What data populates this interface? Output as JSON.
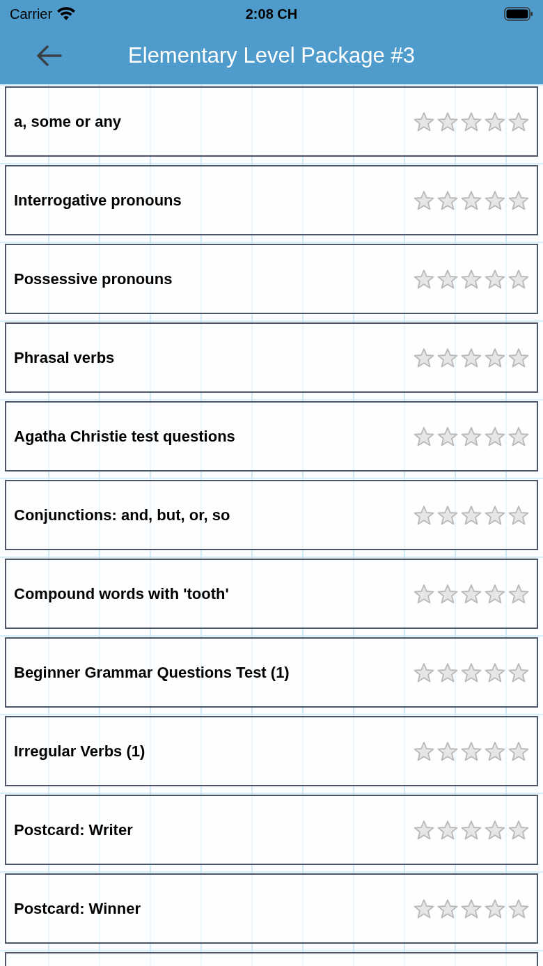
{
  "status_bar": {
    "carrier": "Carrier",
    "time": "2:08 CH"
  },
  "header": {
    "title": "Elementary Level Package #3"
  },
  "lessons": [
    {
      "title": "a, some or any",
      "stars": 0
    },
    {
      "title": "Interrogative pronouns",
      "stars": 0
    },
    {
      "title": "Possessive pronouns",
      "stars": 0
    },
    {
      "title": "Phrasal verbs",
      "stars": 0
    },
    {
      "title": "Agatha Christie test questions",
      "stars": 0
    },
    {
      "title": "Conjunctions: and, but, or, so",
      "stars": 0
    },
    {
      "title": "Compound words with 'tooth'",
      "stars": 0
    },
    {
      "title": "Beginner Grammar Questions Test (1)",
      "stars": 0
    },
    {
      "title": "Irregular Verbs (1)",
      "stars": 0
    },
    {
      "title": "Postcard: Writer",
      "stars": 0
    },
    {
      "title": "Postcard: Winner",
      "stars": 0
    }
  ]
}
